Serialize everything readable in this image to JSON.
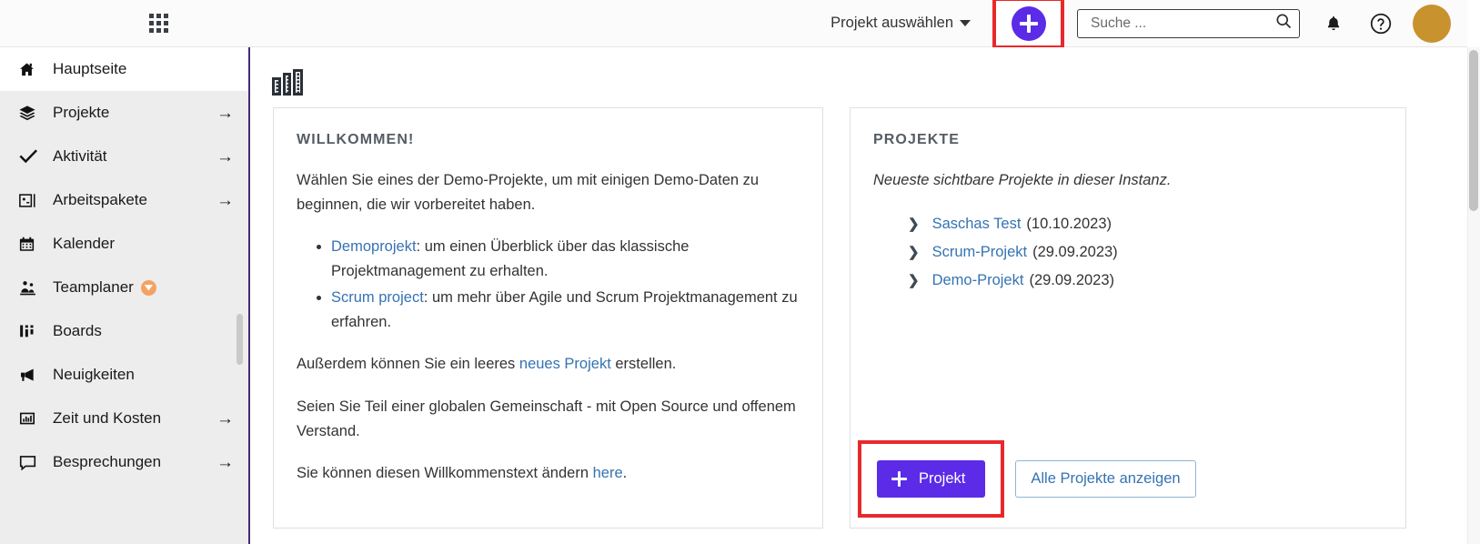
{
  "header": {
    "grid_menu_icon": "grid-apps-icon",
    "project_select_label": "Projekt auswählen",
    "add_button_icon": "plus-icon",
    "search": {
      "placeholder": "Suche ...",
      "value": "",
      "icon": "search-icon"
    },
    "notifications_icon": "bell-icon",
    "help_icon": "help-circle-icon",
    "avatar_icon": "avatar",
    "avatar_color": "#c8922f",
    "accent_color": "#5b2be8",
    "highlight_color": "#e8292b"
  },
  "sidebar": {
    "items": [
      {
        "label": "Hauptseite",
        "icon": "home-icon",
        "active": true,
        "arrow": ""
      },
      {
        "label": "Projekte",
        "icon": "layers-icon",
        "active": false,
        "arrow": "→"
      },
      {
        "label": "Aktivität",
        "icon": "check-icon",
        "active": false,
        "arrow": "→"
      },
      {
        "label": "Arbeitspakete",
        "icon": "work-package-icon",
        "active": false,
        "arrow": "→"
      },
      {
        "label": "Kalender",
        "icon": "calendar-icon",
        "active": false,
        "arrow": ""
      },
      {
        "label": "Teamplaner",
        "icon": "team-planner-icon",
        "active": false,
        "arrow": "",
        "badge": "enterprise-gem-icon"
      },
      {
        "label": "Boards",
        "icon": "boards-icon",
        "active": false,
        "arrow": ""
      },
      {
        "label": "Neuigkeiten",
        "icon": "megaphone-icon",
        "active": false,
        "arrow": ""
      },
      {
        "label": "Zeit und Kosten",
        "icon": "chart-report-icon",
        "active": false,
        "arrow": "→"
      },
      {
        "label": "Besprechungen",
        "icon": "speech-bubble-icon",
        "active": false,
        "arrow": "→"
      }
    ]
  },
  "main": {
    "page_icon": "buildings-icon",
    "welcome_card": {
      "title": "WILLKOMMEN!",
      "intro": "Wählen Sie eines der Demo-Projekte, um mit einigen Demo-Daten zu beginnen, die wir vorbereitet haben.",
      "bullets": [
        {
          "link": "Demoprojekt",
          "rest": ": um einen Überblick über das klassische Projektmanagement zu erhalten."
        },
        {
          "link": "Scrum project",
          "rest": ": um mehr über Agile und Scrum Projektmanagement zu erfahren."
        }
      ],
      "para2_pre": "Außerdem können Sie ein leeres ",
      "para2_link": "neues Projekt",
      "para2_post": " erstellen.",
      "para3": "Seien Sie Teil einer globalen Gemeinschaft - mit Open Source und offenem Verstand.",
      "para4_pre": "Sie können diesen Willkommenstext ändern ",
      "para4_link": "here",
      "para4_post": "."
    },
    "projects_card": {
      "title": "PROJEKTE",
      "subtitle": "Neueste sichtbare Projekte in dieser Instanz.",
      "projects": [
        {
          "name": "Saschas Test",
          "date": "(10.10.2023)"
        },
        {
          "name": "Scrum-Projekt",
          "date": "(29.09.2023)"
        },
        {
          "name": "Demo-Projekt",
          "date": "(29.09.2023)"
        }
      ],
      "new_project_button": "Projekt",
      "view_all_button": "Alle Projekte anzeigen"
    }
  }
}
